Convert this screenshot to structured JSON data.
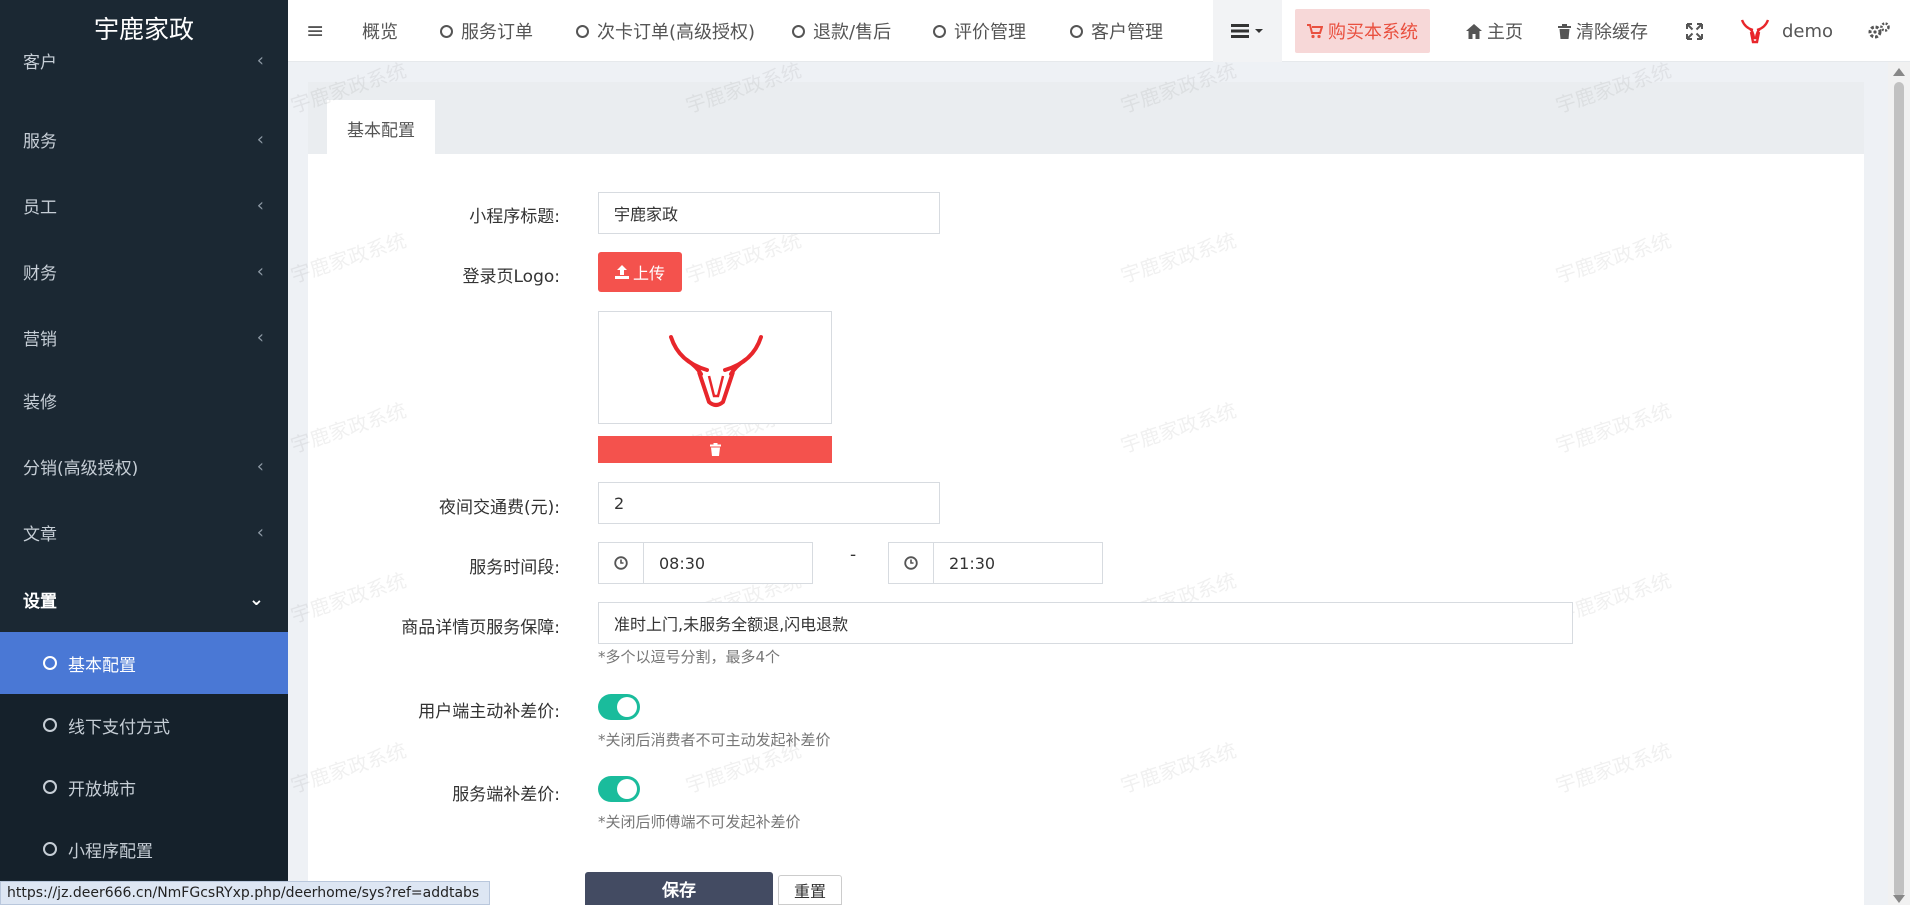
{
  "brand": "宇鹿家政",
  "sidebar": {
    "items": [
      {
        "label": "客户",
        "chevron": "‹"
      },
      {
        "label": "服务",
        "chevron": "‹"
      },
      {
        "label": "员工",
        "chevron": "‹"
      },
      {
        "label": "财务",
        "chevron": "‹"
      },
      {
        "label": "营销",
        "chevron": "‹"
      },
      {
        "label": "装修",
        "chevron": ""
      },
      {
        "label": "分销(高级授权)",
        "chevron": "‹"
      },
      {
        "label": "文章",
        "chevron": "‹"
      },
      {
        "label": "设置",
        "chevron": "⌄"
      }
    ],
    "sub_items": [
      {
        "label": "基本配置"
      },
      {
        "label": "线下支付方式"
      },
      {
        "label": "开放城市"
      },
      {
        "label": "小程序配置"
      }
    ]
  },
  "topbar": {
    "menu_icon": "≡",
    "overview": "概览",
    "service_orders": "服务订单",
    "card_orders": "次卡订单(高级授权)",
    "refunds": "退款/售后",
    "reviews": "评价管理",
    "customers": "客户管理",
    "buy": "购买本系统",
    "home": "主页",
    "clear_cache": "清除缓存",
    "user": "demo"
  },
  "tab": {
    "label": "基本配置"
  },
  "form": {
    "title_label": "小程序标题:",
    "title_value": "宇鹿家政",
    "logo_label": "登录页Logo:",
    "upload_label": "上传",
    "night_fee_label": "夜间交通费(元):",
    "night_fee_value": "2",
    "time_label": "服务时间段:",
    "time_start": "08:30",
    "time_sep": "-",
    "time_end": "21:30",
    "guarantee_label": "商品详情页服务保障:",
    "guarantee_value": "准时上门,未服务全额退,闪电退款",
    "guarantee_hint": "*多个以逗号分割，最多4个",
    "user_diff_label": "用户端主动补差价:",
    "user_diff_hint": "*关闭后消费者不可主动发起补差价",
    "user_diff_on": true,
    "staff_diff_label": "服务端补差价:",
    "staff_diff_hint": "*关闭后师傅端不可发起补差价",
    "staff_diff_on": true,
    "save_label": "保存",
    "reset_label": "重置"
  },
  "watermark": "宇鹿家政系统",
  "status_url": "https://jz.deer666.cn/NmFGcsRYxp.php/deerhome/sys?ref=addtabs",
  "colors": {
    "sidebar_bg": "#1b2833",
    "active_blue": "#4a78d5",
    "red": "#f4524d",
    "toggle_green": "#1abc9c",
    "save_dark": "#434b62"
  }
}
